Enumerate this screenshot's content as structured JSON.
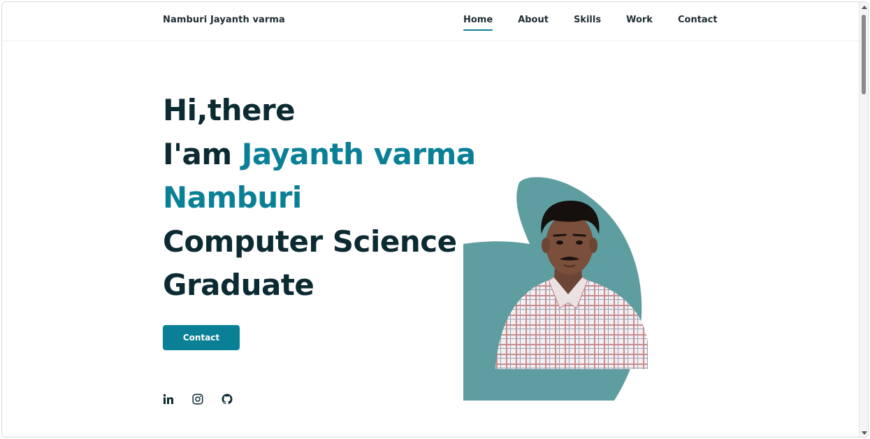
{
  "header": {
    "brand": "Namburi Jayanth varma",
    "nav": [
      {
        "label": "Home",
        "active": true
      },
      {
        "label": "About",
        "active": false
      },
      {
        "label": "Skills",
        "active": false
      },
      {
        "label": "Work",
        "active": false
      },
      {
        "label": "Contact",
        "active": false
      }
    ]
  },
  "hero": {
    "line1": "Hi,there",
    "line2_prefix": "I'am ",
    "line2_name": "Jayanth varma",
    "line3_name": "Namburi",
    "line4": "Computer Science",
    "line5": "Graduate",
    "cta_label": "Contact"
  },
  "socials": [
    {
      "icon": "linkedin-icon"
    },
    {
      "icon": "instagram-icon"
    },
    {
      "icon": "github-icon"
    }
  ],
  "colors": {
    "accent": "#0a8096",
    "text": "#0c2a32",
    "blob": "#5f9ea0"
  }
}
